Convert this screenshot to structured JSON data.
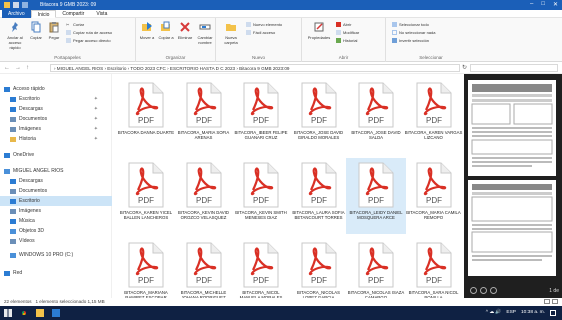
{
  "window": {
    "title": "Bitacora 9 GMB 2023: 09",
    "controls": [
      "–",
      "□",
      "✕"
    ]
  },
  "menu": {
    "tabs": [
      "Archivo",
      "Inicio",
      "Compartir",
      "Vista"
    ],
    "active": "Inicio"
  },
  "ribbon": {
    "clipboard": {
      "pin": "Anclar al acceso rápido",
      "copy": "Copiar",
      "paste": "Pegar",
      "cut": "Cortar",
      "copy_path": "Copiar ruta de acceso",
      "paste_shortcut": "Pegar acceso directo",
      "label": "Portapapeles"
    },
    "organize": {
      "move": "Mover a",
      "copy_to": "Copiar a",
      "delete": "Eliminar",
      "rename": "Cambiar nombre",
      "label": "Organizar"
    },
    "new": {
      "new_folder": "Nueva carpeta",
      "new_item": "Nuevo elemento",
      "easy_access": "Fácil acceso",
      "label": "Nuevo"
    },
    "open": {
      "properties": "Propiedades",
      "open": "Abrir",
      "edit": "Modificar",
      "history": "Historial",
      "label": "Abrir"
    },
    "select": {
      "all": "Seleccionar todo",
      "none": "No seleccionar nada",
      "invert": "Invertir selección",
      "label": "Seleccionar"
    }
  },
  "address": {
    "back": "←",
    "forward": "→",
    "up": "↑",
    "path": "› MIGUEL ANGEL RIOS › Escritorio › TODO 2023 CFC › ESCRITORIO HASTA D C 2023 › Bitacora 9 GMB 2023:09",
    "refresh": "↻"
  },
  "nav": [
    {
      "label": "Acceso rápido",
      "icon": "star-icon",
      "color": "#2b7cd3",
      "pinned": false
    },
    {
      "label": "Escritorio",
      "icon": "desktop-icon",
      "color": "#2b7cd3",
      "pinned": true
    },
    {
      "label": "Descargas",
      "icon": "download-icon",
      "color": "#2b7cd3",
      "pinned": true
    },
    {
      "label": "Documentos",
      "icon": "documents-icon",
      "color": "#6b8fb8",
      "pinned": true
    },
    {
      "label": "Imágenes",
      "icon": "pictures-icon",
      "color": "#6b8fb8",
      "pinned": true
    },
    {
      "label": "Historia",
      "icon": "folder-icon",
      "color": "#e8b84a",
      "pinned": true
    },
    {
      "label": "OneDrive",
      "icon": "cloud-icon",
      "color": "#2b7cd3",
      "pinned": false
    },
    {
      "label": "MIGUEL ANGEL RIOS",
      "icon": "pc-icon",
      "color": "#4a90d9",
      "pinned": false
    },
    {
      "label": "Descargas",
      "icon": "download-icon",
      "color": "#2b7cd3",
      "pinned": false
    },
    {
      "label": "Documentos",
      "icon": "documents-icon",
      "color": "#6b8fb8",
      "pinned": false
    },
    {
      "label": "Escritorio",
      "icon": "desktop-icon",
      "color": "#2b7cd3",
      "pinned": false
    },
    {
      "label": "Imágenes",
      "icon": "pictures-icon",
      "color": "#6b8fb8",
      "pinned": false
    },
    {
      "label": "Música",
      "icon": "music-icon",
      "color": "#2b7cd3",
      "pinned": false
    },
    {
      "label": "Objetos 3D",
      "icon": "cube-icon",
      "color": "#4a90d9",
      "pinned": false
    },
    {
      "label": "Vídeos",
      "icon": "video-icon",
      "color": "#6b8fb8",
      "pinned": false
    },
    {
      "label": "WINDOWS 10 PRO (C:)",
      "icon": "drive-icon",
      "color": "#4a90d9",
      "pinned": false
    },
    {
      "label": "Red",
      "icon": "network-icon",
      "color": "#2b7cd3",
      "pinned": false
    }
  ],
  "nav_selected_index": 10,
  "files": {
    "icon_label": "PDF",
    "items": [
      {
        "name": "BITACORA DANNA DUARTE"
      },
      {
        "name": "BITACORA_Maria Sofia arenas"
      },
      {
        "name": "BITACORA_Ibeer felipe Guanari Cruz"
      },
      {
        "name": "BITACORA_JOSE DAVID GIRALDO MORALES"
      },
      {
        "name": "BITACORA_JOSE DAVID SALDA"
      },
      {
        "name": "BITACORA_Karen Vargas Lizcano"
      },
      {
        "name": "BITACORA_KAREN YICEL BALLEN LANCHEROS"
      },
      {
        "name": "BITACORA_KEVIN DAVID OROZCO VELASQUEZ"
      },
      {
        "name": "BITACORA_KEVIN SMITH MENESES DIAZ"
      },
      {
        "name": "BITACORA_LAURA SOFIA BETANCOURT TORRES"
      },
      {
        "name": "BITACORA_LEIDY DANIEL MOSQUERA ARCE"
      },
      {
        "name": "BITACORA_MARIA CAMILA REMOPO"
      },
      {
        "name": "BITACORA_MARIANA RAMIREZ ESCOBAR"
      },
      {
        "name": "BITACORA_MICHELLE JOHANA RODRIGUEZ"
      },
      {
        "name": "BITACORA_NICOL MANUELA MORALES"
      },
      {
        "name": "BITACORA_NICOLAS LOPEZ GARCIA"
      },
      {
        "name": "BITACORA_Nicolas Isaza Camargo"
      },
      {
        "name": "BITACORA_SARA NICOL BONILLA"
      }
    ],
    "selected_index": 10
  },
  "preview": {
    "page_indicator": "1 de"
  },
  "status": {
    "items": "22 elementos",
    "selection": "1 elemento seleccionado  1,15 MB"
  },
  "taskbar": {
    "lang": "ESP",
    "time": "10:38 a. m.",
    "tray_icons": "^ ☁ 🔊"
  },
  "colors": {
    "accent": "#1b5fb8",
    "pdf_red": "#d93025",
    "selection": "#cce4f7",
    "taskbar": "#0f2143"
  }
}
